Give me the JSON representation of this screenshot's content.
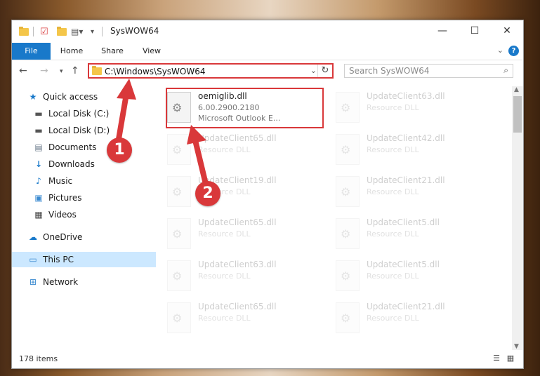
{
  "window": {
    "title": "SysWOW64",
    "controls": {
      "minimize": "—",
      "maximize": "☐",
      "close": "✕"
    }
  },
  "ribbon": {
    "tabs": [
      "File",
      "Home",
      "Share",
      "View"
    ],
    "help": "?"
  },
  "address": {
    "path": "C:\\Windows\\SysWOW64",
    "search_placeholder": "Search SysWOW64"
  },
  "nav_pane": {
    "quick_access": "Quick access",
    "items": [
      {
        "label": "Local Disk (C:)",
        "icon": "drive-icon"
      },
      {
        "label": "Local Disk (D:)",
        "icon": "drive-icon"
      },
      {
        "label": "Documents",
        "icon": "documents-icon"
      },
      {
        "label": "Downloads",
        "icon": "downloads-icon"
      },
      {
        "label": "Music",
        "icon": "music-icon"
      },
      {
        "label": "Pictures",
        "icon": "pictures-icon"
      },
      {
        "label": "Videos",
        "icon": "videos-icon"
      }
    ],
    "onedrive": "OneDrive",
    "this_pc": "This PC",
    "network": "Network"
  },
  "files": [
    {
      "name": "oemiglib.dll",
      "line1": "6.00.2900.2180",
      "line2": "Microsoft Outlook E...",
      "faded": false
    },
    {
      "name": "UpdateClient63.dll",
      "line1": "Resource DLL",
      "faded": true
    },
    {
      "name": "UpdateClient65.dll",
      "line1": "Resource DLL",
      "faded": true
    },
    {
      "name": "UpdateClient42.dll",
      "line1": "Resource DLL",
      "faded": true
    },
    {
      "name": "UpdateClient19.dll",
      "line1": "Resource DLL",
      "faded": true
    },
    {
      "name": "UpdateClient21.dll",
      "line1": "Resource DLL",
      "faded": true
    },
    {
      "name": "UpdateClient65.dll",
      "line1": "Resource DLL",
      "faded": true
    },
    {
      "name": "UpdateClient5.dll",
      "line1": "Resource DLL",
      "faded": true
    },
    {
      "name": "UpdateClient63.dll",
      "line1": "Resource DLL",
      "faded": true
    },
    {
      "name": "UpdateClient5.dll",
      "line1": "Resource DLL",
      "faded": true
    },
    {
      "name": "UpdateClient65.dll",
      "line1": "Resource DLL",
      "faded": true
    },
    {
      "name": "UpdateClient21.dll",
      "line1": "Resource DLL",
      "faded": true
    }
  ],
  "status": {
    "count": "178 items"
  },
  "callouts": [
    "1",
    "2"
  ],
  "colors": {
    "accent": "#1979ca",
    "annotation": "#d9383a",
    "selected": "#cce8ff"
  }
}
